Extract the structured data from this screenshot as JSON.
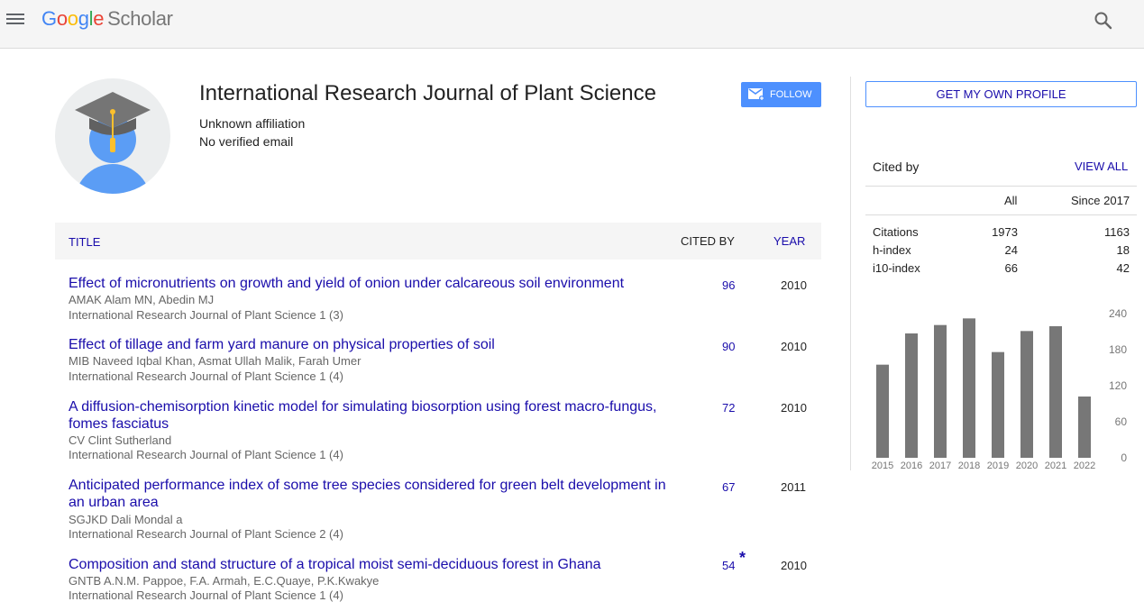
{
  "header": {
    "logo_google": "Google",
    "logo_scholar": "Scholar"
  },
  "profile": {
    "name": "International Research Journal of Plant Science",
    "affiliation": "Unknown affiliation",
    "email": "No verified email",
    "follow_label": "FOLLOW"
  },
  "table": {
    "col_title": "TITLE",
    "col_cited": "CITED BY",
    "col_year": "YEAR",
    "articles": [
      {
        "title": "Effect of micronutrients on growth and yield of onion under calcareous soil environment",
        "authors": "AMAK Alam MN, Abedin MJ",
        "venue": "International Research Journal of Plant Science 1 (3)",
        "cited": "96",
        "year": "2010",
        "star": ""
      },
      {
        "title": "Effect of tillage and farm yard manure on physical properties of soil",
        "authors": "MIB Naveed Iqbal Khan, Asmat Ullah Malik, Farah Umer",
        "venue": "International Research Journal of Plant Science 1 (4)",
        "cited": "90",
        "year": "2010",
        "star": ""
      },
      {
        "title": "A diffusion-chemisorption kinetic model for simulating biosorption using forest macro-fungus, fomes fasciatus",
        "authors": "CV Clint Sutherland",
        "venue": "International Research Journal of Plant Science 1 (4)",
        "cited": "72",
        "year": "2010",
        "star": ""
      },
      {
        "title": "Anticipated performance index of some tree species considered for green belt development in an urban area",
        "authors": "SGJKD Dali Mondal a",
        "venue": "International Research Journal of Plant Science 2 (4)",
        "cited": "67",
        "year": "2011",
        "star": ""
      },
      {
        "title": "Composition and stand structure of a tropical moist semi-deciduous forest in Ghana",
        "authors": "GNTB A.N.M. Pappoe, F.A. Armah, E.C.Quaye, P.K.Kwakye",
        "venue": "International Research Journal of Plant Science 1 (4)",
        "cited": "54",
        "year": "2010",
        "star": "*"
      }
    ]
  },
  "sidebar": {
    "get_profile_label": "GET MY OWN PROFILE",
    "cited_by_label": "Cited by",
    "view_all_label": "VIEW ALL",
    "col_all": "All",
    "col_since": "Since 2017",
    "stats": [
      {
        "label": "Citations",
        "all": "1973",
        "since": "1163"
      },
      {
        "label": "h-index",
        "all": "24",
        "since": "18"
      },
      {
        "label": "i10-index",
        "all": "66",
        "since": "42"
      }
    ]
  },
  "colors": {
    "link": "#1a0dab",
    "follow_button": "#4d90fe",
    "bar": "#777777"
  },
  "chart_data": {
    "type": "bar",
    "categories": [
      "2015",
      "2016",
      "2017",
      "2018",
      "2019",
      "2020",
      "2021",
      "2022"
    ],
    "values": [
      155,
      207,
      221,
      232,
      176,
      211,
      219,
      102
    ],
    "y_ticks": [
      "240",
      "180",
      "120",
      "60",
      "0"
    ],
    "ylim": [
      0,
      240
    ]
  }
}
